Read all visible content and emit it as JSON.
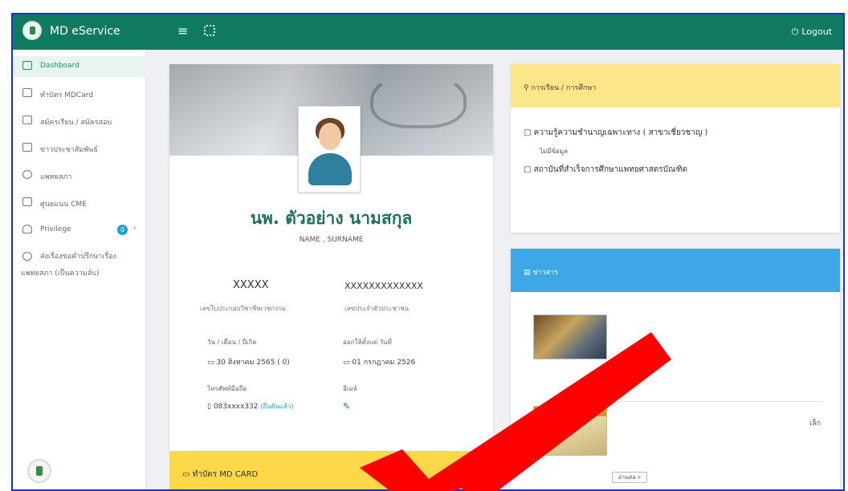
{
  "app": {
    "brand": "MD eService",
    "logout_label": "Logout"
  },
  "sidebar": {
    "items": [
      {
        "label": "Dashboard",
        "active": true
      },
      {
        "label": "ทำบัตร MDCard"
      },
      {
        "label": "สมัครเรียน / สมัครสอบ"
      },
      {
        "label": "ข่าวประชาสัมพันธ์"
      },
      {
        "label": "แพทยสภา"
      },
      {
        "label": "ศูนยแนน CME"
      },
      {
        "label": "Privilege",
        "badge": "0"
      },
      {
        "label": "ส่งเรื่องขอคำปรึกษาเรื่อง",
        "label_line2": "แพทยสภา (เป็นความลับ)"
      }
    ]
  },
  "profile": {
    "name": "นพ. ตัวอย่าง นามสกุล",
    "name_sub": "NAME , SURNAME",
    "license_no": "XXXXX",
    "license_label": "เลขใบประกอบวิชาชีพเวชกรรม",
    "citizen_id": "XXXXXXXXXXXXX",
    "citizen_label": "เลขประจำตัวประชาชน",
    "birth_label": "วัน / เดือน / ปีเกิด",
    "birth_value": "30 สิงหาคม 2565 (   0)",
    "issue_label": "ออกให้ตั้งแต่ วันที่",
    "issue_value": "01 กรกฎาคม 2526",
    "phone_label": "โทรศัพท์มือถือ",
    "phone_value": "083xxxx332",
    "phone_note": "(ยืนยันแล้ว)",
    "email_label": "อีเมล์"
  },
  "mdcard": {
    "title": "ทำบัตร MD CARD"
  },
  "education": {
    "title": "การเรียน / การศึกษา",
    "items": [
      {
        "label": "ความรู้ความชำนาญเฉพาะทาง ( สาขาเชี่ยวชาญ )",
        "sub": "ไม่มีข้อมูล"
      },
      {
        "label": "สถาบันที่สำเร็จการศึกษาแพทยศาสตรบัณฑิต"
      }
    ]
  },
  "news": {
    "title": "ข่าวสาร",
    "row2_suffix": "เล็ก",
    "more_label": "อ่านต่อ »"
  },
  "colors": {
    "topbar": "#0f7a5f",
    "accent_green": "#1d7060",
    "news_blue": "#3ea7e6",
    "highlight_yellow": "#ffd84a",
    "arrow_red": "#ff0000"
  }
}
